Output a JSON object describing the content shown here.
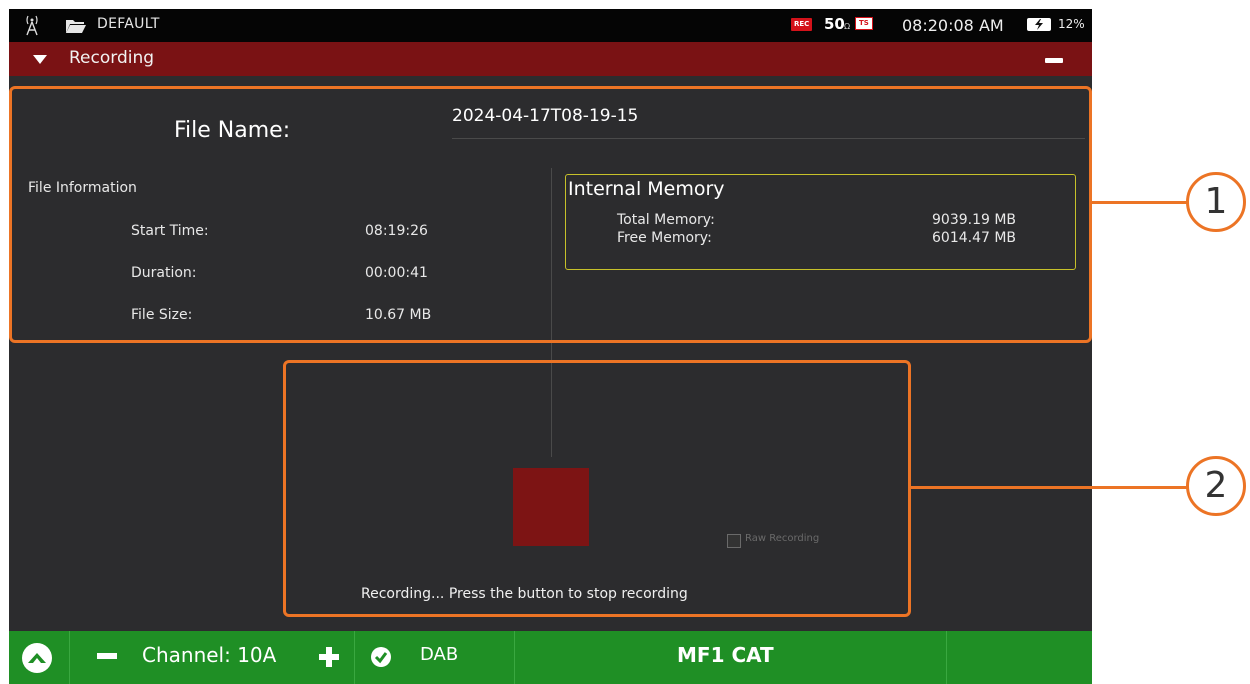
{
  "status_bar": {
    "profile": "DEFAULT",
    "rec_badge": "REC",
    "frame_rate": "50",
    "frame_rate_suffix": "Ω",
    "ts_badge": "TS",
    "time": "08:20:08 AM",
    "battery_percent": "12%"
  },
  "panel": {
    "title": "Recording"
  },
  "file": {
    "name_label": "File Name:",
    "name_value": "2024-04-17T08-19-15"
  },
  "file_info": {
    "title": "File Information",
    "rows": [
      {
        "label": "Start Time:",
        "value": "08:19:26"
      },
      {
        "label": "Duration:",
        "value": "00:00:41"
      },
      {
        "label": "File Size:",
        "value": "10.67 MB"
      }
    ]
  },
  "memory": {
    "title": "Internal Memory",
    "rows": [
      {
        "label": "Total Memory:",
        "value": "9039.19 MB"
      },
      {
        "label": "Free Memory:",
        "value": "6014.47 MB"
      }
    ]
  },
  "controls": {
    "raw_recording_label": "Raw Recording",
    "raw_recording_checked": false,
    "status_message": "Recording... Press the button to stop recording"
  },
  "bottom_bar": {
    "channel": "Channel: 10A",
    "standard": "DAB",
    "measure_profile": "MF1 CAT"
  },
  "callouts": [
    "1",
    "2"
  ],
  "colors": {
    "title_bar": "#7a1214",
    "panel_bg": "#2c2c2e",
    "stop_button": "#7d1414",
    "memory_box_border": "#c7c12a",
    "callout": "#ec7425",
    "bottom_bar": "#1f8f25"
  }
}
